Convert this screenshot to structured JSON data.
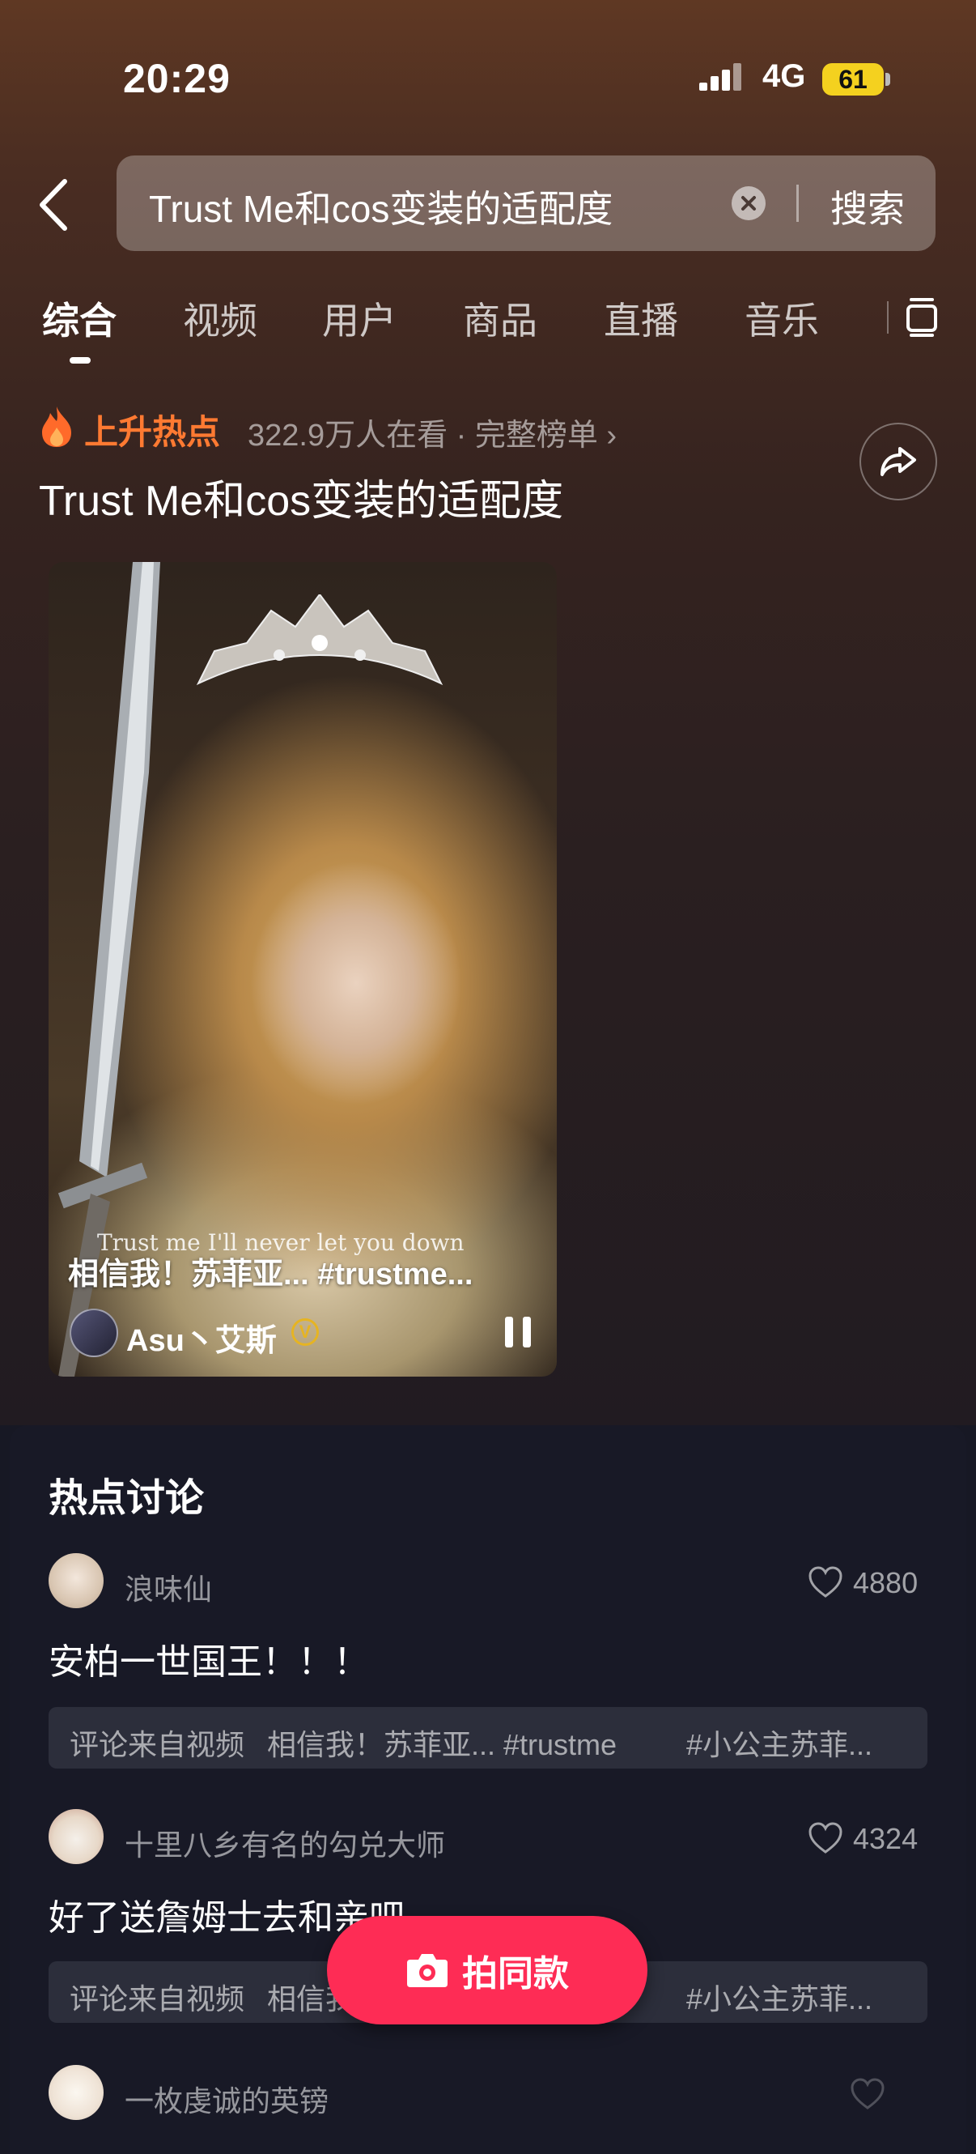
{
  "status_bar": {
    "time": "20:29",
    "network": "4G",
    "battery": "61"
  },
  "search": {
    "query": "Trust Me和cos变装的适配度",
    "button_label": "搜索"
  },
  "tabs": [
    {
      "label": "综合"
    },
    {
      "label": "视频"
    },
    {
      "label": "用户"
    },
    {
      "label": "商品"
    },
    {
      "label": "直播"
    },
    {
      "label": "音乐"
    }
  ],
  "hot_topic": {
    "label": "上升热点",
    "watchers": "322.9万人在看 · 完整榜单 ›",
    "title": "Trust Me和cos变装的适配度"
  },
  "video": {
    "subtitle": "Trust me I'll never let you down",
    "caption": "相信我！苏菲亚... #trustme...",
    "author": "Asu丶艾斯",
    "verified_mark": "V"
  },
  "discussion": {
    "title": "热点讨论",
    "comments": [
      {
        "user": "浪味仙",
        "likes": "4880",
        "text": "安柏一世国王！！！",
        "source_prefix": "评论来自视频",
        "source_video": "相信我！苏菲亚... #trustme",
        "source_tag": "#小公主苏菲..."
      },
      {
        "user": "十里八乡有名的勾兑大师",
        "likes": "4324",
        "text": "好了送詹姆士去和亲吧",
        "source_prefix": "评论来自视频",
        "source_video": "相信我！苏菲亚... #trustme",
        "source_tag": "#小公主苏菲..."
      },
      {
        "user": "一枚虔诚的英镑"
      }
    ]
  },
  "shoot_button": {
    "label": "拍同款"
  },
  "colors": {
    "accent": "#fe2c55",
    "hot": "#ff7a32",
    "battery": "#f4d11f"
  }
}
